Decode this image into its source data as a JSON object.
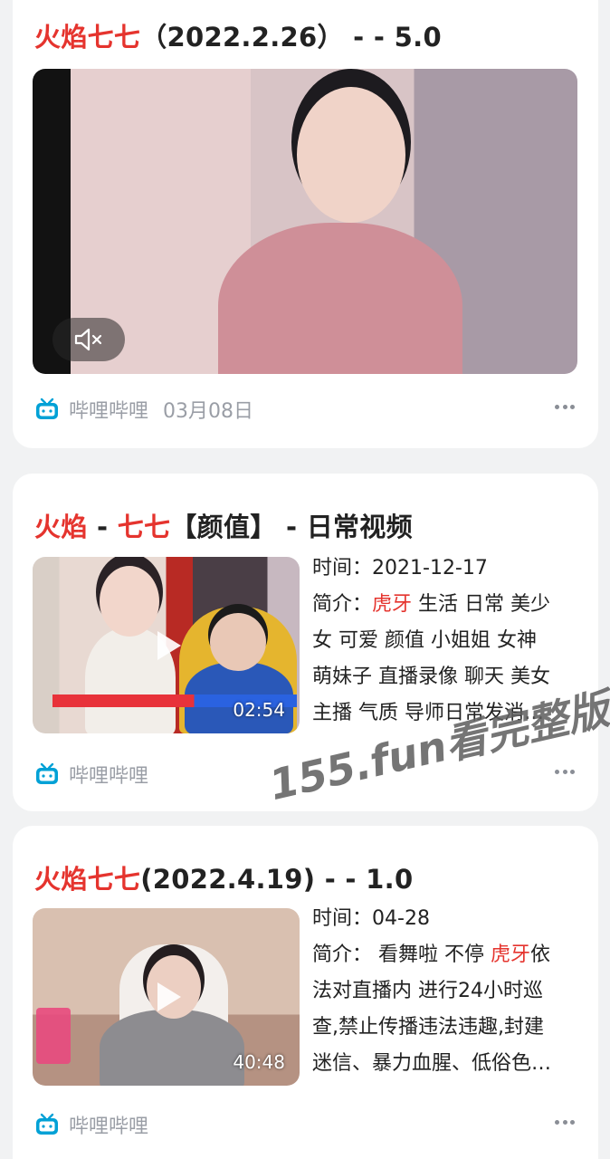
{
  "cards": [
    {
      "title_hl": "火焰七七",
      "title_rest": "（2022.2.26） - - 5.0",
      "source": "哔哩哔哩",
      "date": "03月08日"
    },
    {
      "title_hl1": "火焰",
      "title_mid": " - ",
      "title_hl2": "七七",
      "title_rest": "【颜值】 - 日常视频",
      "duration": "02:54",
      "time_label": "时间：",
      "time_value": "2021-12-17",
      "desc_label": "简介：",
      "desc_hl": "虎牙",
      "desc_line1_rest": " 生活 日常 美少",
      "desc_line2": "女 可爱 颜值 小姐姐 女神",
      "desc_line3": "萌妹子 直播录像 聊天 美女",
      "desc_line4": "主播 气质 导师日常发消…",
      "source": "哔哩哔哩"
    },
    {
      "title_hl": "火焰七七",
      "title_rest": "(2022.4.19) - - 1.0",
      "duration": "40:48",
      "time_label": "时间：",
      "time_value": "04-28",
      "desc_label": "简介：",
      "desc_pre": " 看舞啦 不停 ",
      "desc_hl": "虎牙",
      "desc_line1_rest": "依",
      "desc_line2": "法对直播内 进行24小时巡",
      "desc_line3": "查,禁止传播违法违趣,封建",
      "desc_line4": "迷信、暴力血腥、低俗色…",
      "source": "哔哩哔哩"
    }
  ],
  "watermark": "155.fun看完整版",
  "colors": {
    "accent": "#e5342e",
    "bili": "#00a1d6",
    "meta_gray": "#9a9ea6"
  },
  "icons": {
    "mute": "speaker-muted-icon",
    "play": "play-icon",
    "source": "bilibili-tv-icon",
    "more": "more-dots-icon"
  }
}
